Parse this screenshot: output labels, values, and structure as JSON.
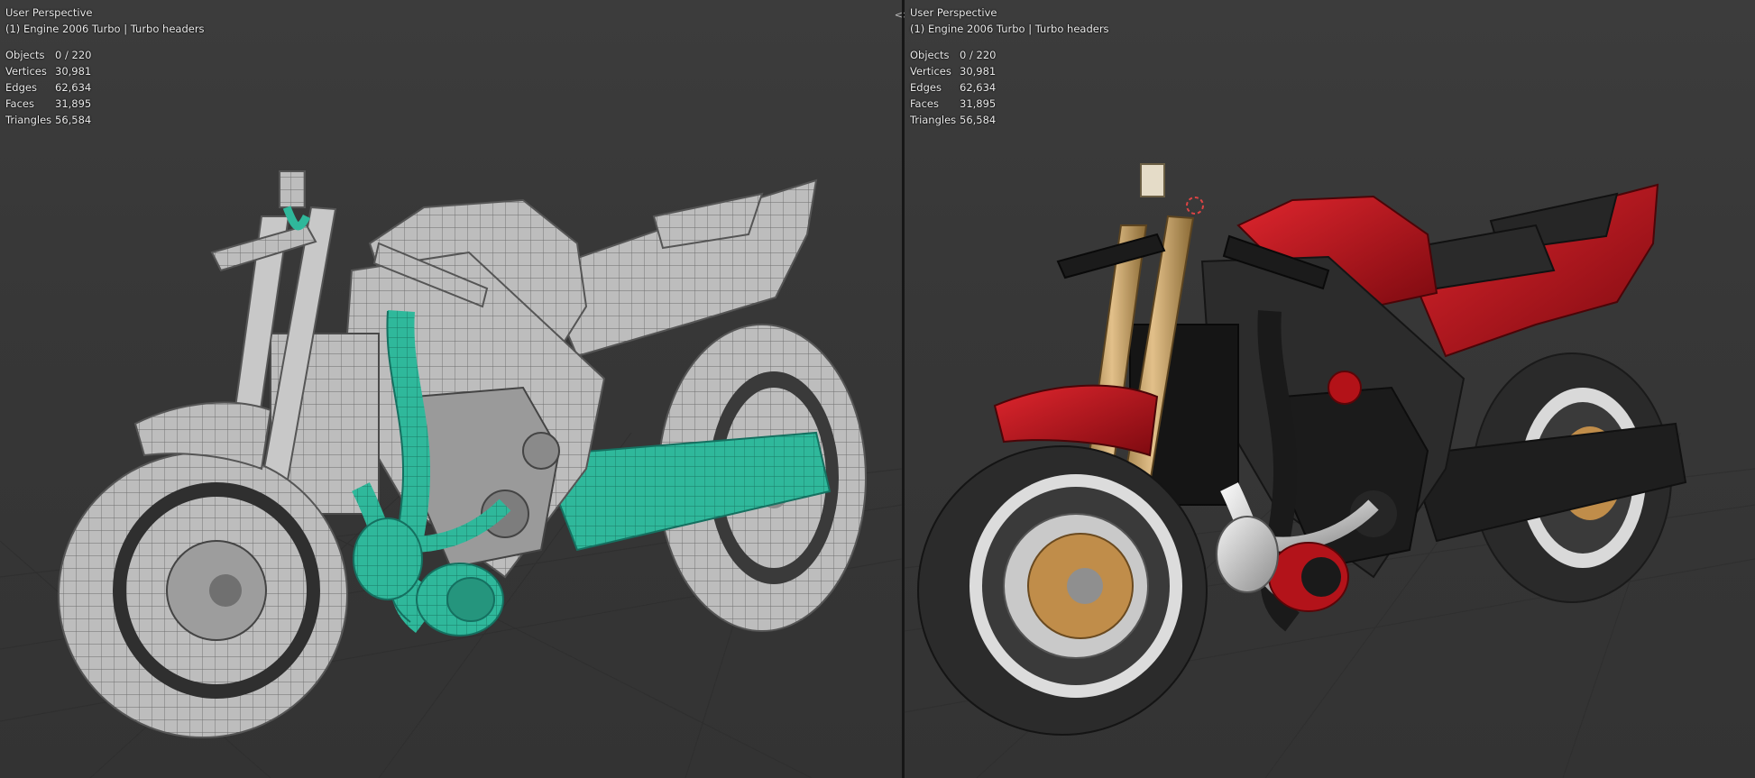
{
  "viewports": [
    {
      "perspective": "User Perspective",
      "object_info": "(1) Engine 2006 Turbo | Turbo headers",
      "stats": [
        {
          "label": "Objects",
          "value": "0 / 220"
        },
        {
          "label": "Vertices",
          "value": "30,981"
        },
        {
          "label": "Edges",
          "value": "62,634"
        },
        {
          "label": "Faces",
          "value": "31,895"
        },
        {
          "label": "Triangles",
          "value": "56,584"
        }
      ],
      "shading": "wireframe-solid",
      "model_color": "#bdbdbd",
      "highlight_color": "#2fb89b"
    },
    {
      "perspective": "User Perspective",
      "object_info": "(1) Engine 2006 Turbo | Turbo headers",
      "stats": [
        {
          "label": "Objects",
          "value": "0 / 220"
        },
        {
          "label": "Vertices",
          "value": "30,981"
        },
        {
          "label": "Edges",
          "value": "62,634"
        },
        {
          "label": "Faces",
          "value": "31,895"
        },
        {
          "label": "Triangles",
          "value": "56,584"
        }
      ],
      "shading": "material-preview",
      "model_color": "#c0121a",
      "highlight_color": "#c9a25a"
    }
  ],
  "icons": {
    "join_area": "area-join-arrows-icon",
    "origin_cursor": "3d-cursor-icon"
  }
}
